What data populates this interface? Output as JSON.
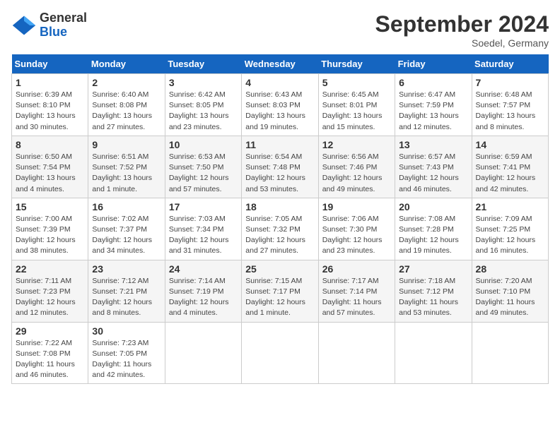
{
  "header": {
    "logo_general": "General",
    "logo_blue": "Blue",
    "month_title": "September 2024",
    "subtitle": "Soedel, Germany"
  },
  "days_of_week": [
    "Sunday",
    "Monday",
    "Tuesday",
    "Wednesday",
    "Thursday",
    "Friday",
    "Saturday"
  ],
  "weeks": [
    [
      {
        "num": "1",
        "detail": "Sunrise: 6:39 AM\nSunset: 8:10 PM\nDaylight: 13 hours\nand 30 minutes."
      },
      {
        "num": "2",
        "detail": "Sunrise: 6:40 AM\nSunset: 8:08 PM\nDaylight: 13 hours\nand 27 minutes."
      },
      {
        "num": "3",
        "detail": "Sunrise: 6:42 AM\nSunset: 8:05 PM\nDaylight: 13 hours\nand 23 minutes."
      },
      {
        "num": "4",
        "detail": "Sunrise: 6:43 AM\nSunset: 8:03 PM\nDaylight: 13 hours\nand 19 minutes."
      },
      {
        "num": "5",
        "detail": "Sunrise: 6:45 AM\nSunset: 8:01 PM\nDaylight: 13 hours\nand 15 minutes."
      },
      {
        "num": "6",
        "detail": "Sunrise: 6:47 AM\nSunset: 7:59 PM\nDaylight: 13 hours\nand 12 minutes."
      },
      {
        "num": "7",
        "detail": "Sunrise: 6:48 AM\nSunset: 7:57 PM\nDaylight: 13 hours\nand 8 minutes."
      }
    ],
    [
      {
        "num": "8",
        "detail": "Sunrise: 6:50 AM\nSunset: 7:54 PM\nDaylight: 13 hours\nand 4 minutes."
      },
      {
        "num": "9",
        "detail": "Sunrise: 6:51 AM\nSunset: 7:52 PM\nDaylight: 13 hours\nand 1 minute."
      },
      {
        "num": "10",
        "detail": "Sunrise: 6:53 AM\nSunset: 7:50 PM\nDaylight: 12 hours\nand 57 minutes."
      },
      {
        "num": "11",
        "detail": "Sunrise: 6:54 AM\nSunset: 7:48 PM\nDaylight: 12 hours\nand 53 minutes."
      },
      {
        "num": "12",
        "detail": "Sunrise: 6:56 AM\nSunset: 7:46 PM\nDaylight: 12 hours\nand 49 minutes."
      },
      {
        "num": "13",
        "detail": "Sunrise: 6:57 AM\nSunset: 7:43 PM\nDaylight: 12 hours\nand 46 minutes."
      },
      {
        "num": "14",
        "detail": "Sunrise: 6:59 AM\nSunset: 7:41 PM\nDaylight: 12 hours\nand 42 minutes."
      }
    ],
    [
      {
        "num": "15",
        "detail": "Sunrise: 7:00 AM\nSunset: 7:39 PM\nDaylight: 12 hours\nand 38 minutes."
      },
      {
        "num": "16",
        "detail": "Sunrise: 7:02 AM\nSunset: 7:37 PM\nDaylight: 12 hours\nand 34 minutes."
      },
      {
        "num": "17",
        "detail": "Sunrise: 7:03 AM\nSunset: 7:34 PM\nDaylight: 12 hours\nand 31 minutes."
      },
      {
        "num": "18",
        "detail": "Sunrise: 7:05 AM\nSunset: 7:32 PM\nDaylight: 12 hours\nand 27 minutes."
      },
      {
        "num": "19",
        "detail": "Sunrise: 7:06 AM\nSunset: 7:30 PM\nDaylight: 12 hours\nand 23 minutes."
      },
      {
        "num": "20",
        "detail": "Sunrise: 7:08 AM\nSunset: 7:28 PM\nDaylight: 12 hours\nand 19 minutes."
      },
      {
        "num": "21",
        "detail": "Sunrise: 7:09 AM\nSunset: 7:25 PM\nDaylight: 12 hours\nand 16 minutes."
      }
    ],
    [
      {
        "num": "22",
        "detail": "Sunrise: 7:11 AM\nSunset: 7:23 PM\nDaylight: 12 hours\nand 12 minutes."
      },
      {
        "num": "23",
        "detail": "Sunrise: 7:12 AM\nSunset: 7:21 PM\nDaylight: 12 hours\nand 8 minutes."
      },
      {
        "num": "24",
        "detail": "Sunrise: 7:14 AM\nSunset: 7:19 PM\nDaylight: 12 hours\nand 4 minutes."
      },
      {
        "num": "25",
        "detail": "Sunrise: 7:15 AM\nSunset: 7:17 PM\nDaylight: 12 hours\nand 1 minute."
      },
      {
        "num": "26",
        "detail": "Sunrise: 7:17 AM\nSunset: 7:14 PM\nDaylight: 11 hours\nand 57 minutes."
      },
      {
        "num": "27",
        "detail": "Sunrise: 7:18 AM\nSunset: 7:12 PM\nDaylight: 11 hours\nand 53 minutes."
      },
      {
        "num": "28",
        "detail": "Sunrise: 7:20 AM\nSunset: 7:10 PM\nDaylight: 11 hours\nand 49 minutes."
      }
    ],
    [
      {
        "num": "29",
        "detail": "Sunrise: 7:22 AM\nSunset: 7:08 PM\nDaylight: 11 hours\nand 46 minutes."
      },
      {
        "num": "30",
        "detail": "Sunrise: 7:23 AM\nSunset: 7:05 PM\nDaylight: 11 hours\nand 42 minutes."
      },
      {
        "num": "",
        "detail": ""
      },
      {
        "num": "",
        "detail": ""
      },
      {
        "num": "",
        "detail": ""
      },
      {
        "num": "",
        "detail": ""
      },
      {
        "num": "",
        "detail": ""
      }
    ]
  ]
}
